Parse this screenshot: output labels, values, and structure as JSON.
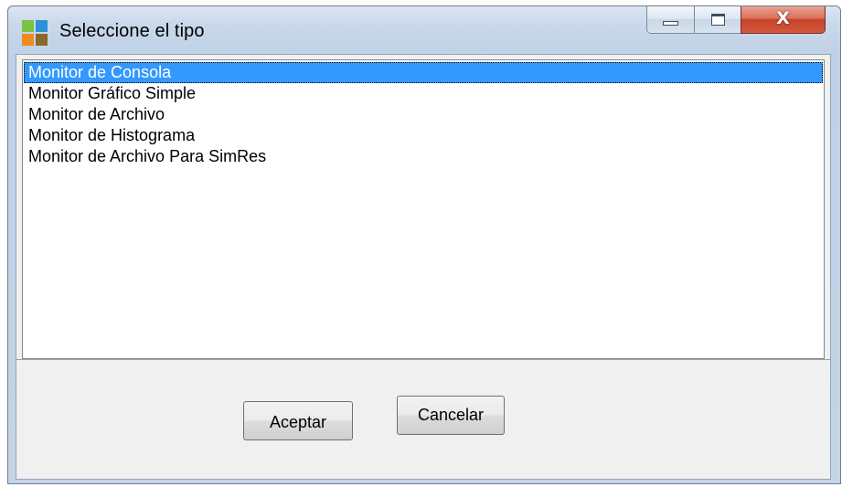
{
  "window": {
    "title": "Seleccione el tipo",
    "close_glyph": "X"
  },
  "listbox": {
    "items": [
      "Monitor de Consola",
      "Monitor Gráfico Simple",
      "Monitor de Archivo",
      "Monitor de Histograma",
      "Monitor de Archivo Para SimRes"
    ],
    "selected_index": 0
  },
  "buttons": {
    "accept_label": "Aceptar",
    "cancel_label": "Cancelar"
  },
  "colors": {
    "selection": "#3399ff",
    "close_button": "#c7432a",
    "icon_green": "#7cc242",
    "icon_blue": "#2f8fd8",
    "icon_orange": "#f08c1e",
    "icon_olive": "#8a6a2a"
  },
  "icons": {
    "app": "app-grid-icon",
    "minimize": "minimize-icon",
    "maximize": "maximize-icon",
    "close": "close-icon"
  }
}
